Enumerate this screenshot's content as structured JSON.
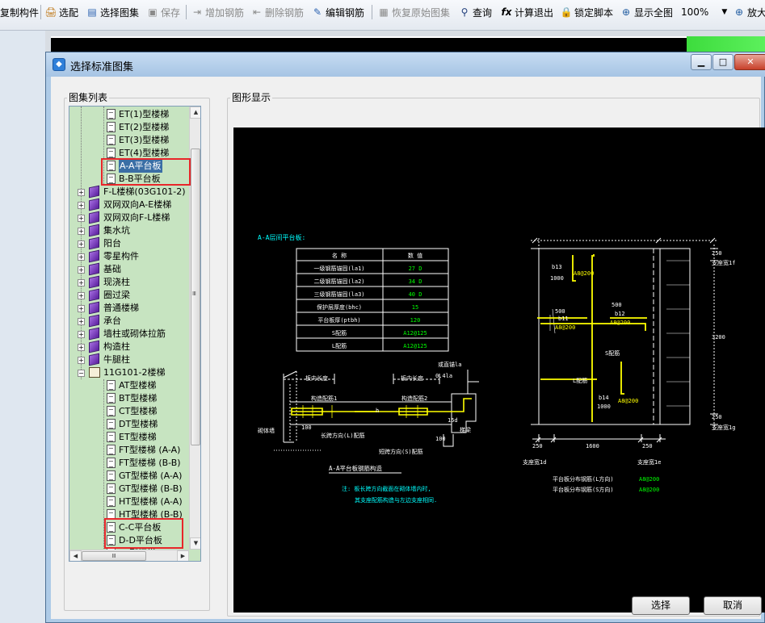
{
  "toolbar": {
    "copy_component": "复制构件",
    "pick": "选配",
    "select_atlas": "选择图集",
    "save": "保存",
    "add_rebar": "增加钢筋",
    "delete_rebar": "删除钢筋",
    "edit_rebar": "编辑钢筋",
    "restore_original": "恢复原始图集",
    "query": "查询",
    "calc_exit": "计算退出",
    "lock_script": "锁定脚本",
    "show_full": "显示全图",
    "zoom_value": "100%",
    "zoom_in": "放大"
  },
  "dialog": {
    "title": "选择标准图集",
    "atlas_list_label": "图集列表",
    "graphic_display_label": "图形显示",
    "select_button": "选择",
    "cancel_button": "取消"
  },
  "tree": {
    "items": [
      {
        "label": "ET(1)型楼梯",
        "kind": "doc",
        "level": 2
      },
      {
        "label": "ET(2)型楼梯",
        "kind": "doc",
        "level": 2
      },
      {
        "label": "ET(3)型楼梯",
        "kind": "doc",
        "level": 2
      },
      {
        "label": "ET(4)型楼梯",
        "kind": "doc",
        "level": 2
      },
      {
        "label": "A-A平台板",
        "kind": "doc",
        "level": 2,
        "selected": true
      },
      {
        "label": "B-B平台板",
        "kind": "doc",
        "level": 2
      },
      {
        "label": "F-L楼梯(03G101-2)",
        "kind": "book",
        "level": 1
      },
      {
        "label": "双网双向A-E楼梯",
        "kind": "book",
        "level": 1
      },
      {
        "label": "双网双向F-L楼梯",
        "kind": "book",
        "level": 1
      },
      {
        "label": "集水坑",
        "kind": "book",
        "level": 1
      },
      {
        "label": "阳台",
        "kind": "book",
        "level": 1
      },
      {
        "label": "零星构件",
        "kind": "book",
        "level": 1
      },
      {
        "label": "基础",
        "kind": "book",
        "level": 1
      },
      {
        "label": "现浇柱",
        "kind": "book",
        "level": 1
      },
      {
        "label": "圈过梁",
        "kind": "book",
        "level": 1
      },
      {
        "label": "普通楼梯",
        "kind": "book",
        "level": 1
      },
      {
        "label": "承台",
        "kind": "book",
        "level": 1
      },
      {
        "label": "墙柱或砌体拉筋",
        "kind": "book",
        "level": 1
      },
      {
        "label": "构造柱",
        "kind": "book",
        "level": 1
      },
      {
        "label": "牛腿柱",
        "kind": "book",
        "level": 1
      },
      {
        "label": "11G101-2楼梯",
        "kind": "open",
        "level": 1
      },
      {
        "label": "AT型楼梯",
        "kind": "doc",
        "level": 2
      },
      {
        "label": "BT型楼梯",
        "kind": "doc",
        "level": 2
      },
      {
        "label": "CT型楼梯",
        "kind": "doc",
        "level": 2
      },
      {
        "label": "DT型楼梯",
        "kind": "doc",
        "level": 2
      },
      {
        "label": "ET型楼梯",
        "kind": "doc",
        "level": 2
      },
      {
        "label": "FT型楼梯 (A-A)",
        "kind": "doc",
        "level": 2
      },
      {
        "label": "FT型楼梯 (B-B)",
        "kind": "doc",
        "level": 2
      },
      {
        "label": "GT型楼梯 (A-A)",
        "kind": "doc",
        "level": 2
      },
      {
        "label": "GT型楼梯 (B-B)",
        "kind": "doc",
        "level": 2
      },
      {
        "label": "HT型楼梯 (A-A)",
        "kind": "doc",
        "level": 2
      },
      {
        "label": "HT型楼梯 (B-B)",
        "kind": "doc",
        "level": 2
      },
      {
        "label": "C-C平台板",
        "kind": "doc",
        "level": 2
      },
      {
        "label": "D-D平台板",
        "kind": "doc",
        "level": 2
      },
      {
        "label": "FT型楼梯 (A-A)",
        "kind": "doc",
        "level": 2
      }
    ],
    "scroll_thumb_grip": "Ⅲ"
  },
  "drawing": {
    "heading": "A-A层间平台板:",
    "table_headers": [
      "名 称",
      "数 值"
    ],
    "table_rows": [
      [
        "一级钢筋锚固(la1)",
        "27 D"
      ],
      [
        "二级钢筋锚固(la2)",
        "34 D"
      ],
      [
        "三级钢筋锚固(la3)",
        "40 D"
      ],
      [
        "保护层厚度(bhc)",
        "15"
      ],
      [
        "平台板厚(ptbh)",
        "120"
      ],
      [
        "S配筋",
        "A12@125"
      ],
      [
        "L配筋",
        "A12@125"
      ]
    ],
    "sect": {
      "slab_len_left": "板内长度",
      "slab_len_right": "板内长度",
      "straight_anchor": "或直锚la",
      "pt4la": "0.4la",
      "constr_rebar1": "构造配筋1",
      "constr_rebar2": "构造配筋2",
      "h": "h",
      "d15": "15d",
      "masonry": "砌体墙",
      "d100a": "100",
      "long_rebar": "长跨方向(L)配筋",
      "short_rebar": "短跨方向(S)配筋",
      "d100b": "100",
      "ladder_beam": "梯梁",
      "caption": "A-A平台板钢筋构造",
      "note1": "注: 板长跨方向截面在砌体墙内时,",
      "note2": "其支座配筋构造与左边支座相同."
    },
    "plan": {
      "d250_top": "250",
      "support_1f": "支座宽1f",
      "b13": "b13",
      "d1000_a": "1000",
      "a8_1": "A8@200",
      "d500_a": "500",
      "b11": "b11",
      "a8_2": "A8@200",
      "d500_b": "500",
      "b12": "b12",
      "a8_3": "A8@200",
      "s_rebar": "S配筋",
      "d3200": "3200",
      "l_rebar": "L配筋",
      "b14": "b14",
      "d1000_b": "1000",
      "a8_4": "A8@200",
      "d250_bot": "250",
      "support_1g": "支座宽1g",
      "d250_left": "250",
      "d1600": "1600",
      "d250_right": "250",
      "support_1d": "支座宽1d",
      "support_1e": "支座宽1e",
      "dist_l_label": "平台板分布钢筋(L方向)",
      "dist_l_value": "A8@200",
      "dist_s_label": "平台板分布钢筋(S方向)",
      "dist_s_value": "A8@200"
    }
  },
  "colors": {
    "tree_bg": "#c7e4c1",
    "drawing_bg": "#000000",
    "drawing_line": "#ffffff",
    "rebar": "#ffff00",
    "cyan_text": "#00ffff",
    "highlight_box": "#e8262a",
    "selection": "#3a6ea5"
  },
  "icons": [
    "copy-icon",
    "pick-icon",
    "atlas-icon",
    "save-icon",
    "add-rebar-icon",
    "delete-rebar-icon",
    "edit-rebar-icon",
    "restore-icon",
    "binoculars-icon",
    "fx-icon",
    "lock-icon",
    "zoom-full-icon",
    "zoom-in-icon"
  ]
}
